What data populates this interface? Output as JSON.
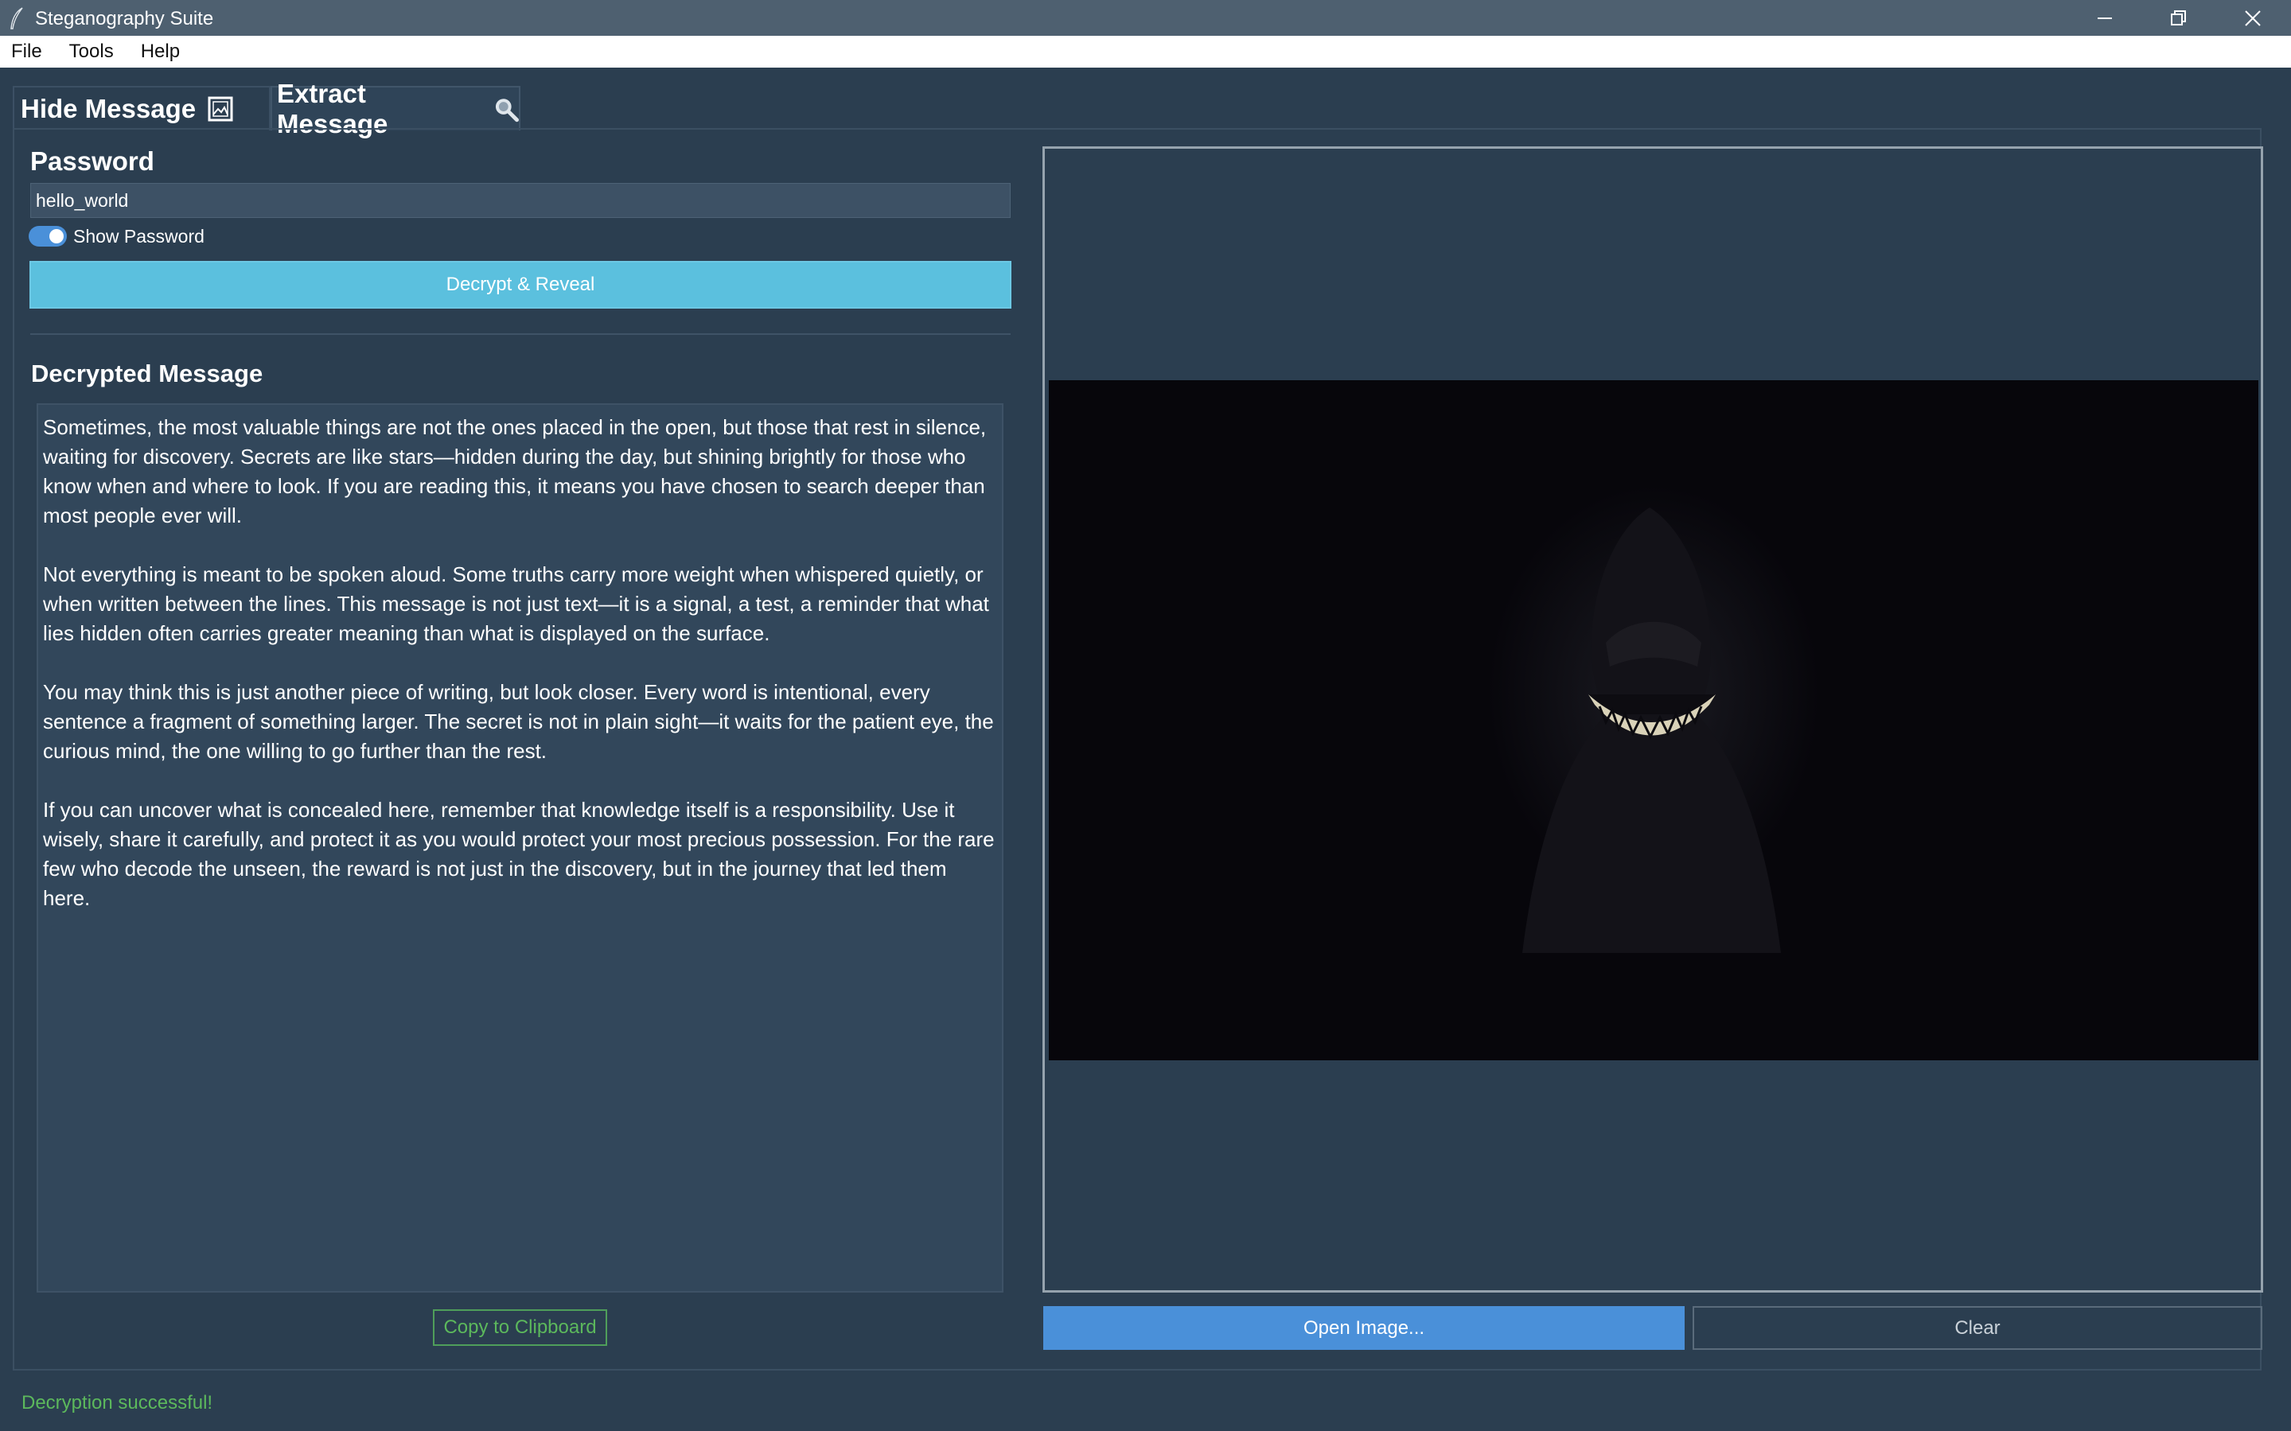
{
  "window": {
    "title": "Steganography Suite",
    "icon": "feather-icon",
    "controls": [
      "minimize-icon",
      "restore-icon",
      "close-icon"
    ]
  },
  "menu": {
    "items": [
      "File",
      "Tools",
      "Help"
    ]
  },
  "tabs": [
    {
      "label": "Hide Message",
      "icon": "image-icon",
      "active": false
    },
    {
      "label": "Extract Message",
      "icon": "magnifier-icon",
      "active": true
    }
  ],
  "password": {
    "label": "Password",
    "value": "hello_world",
    "show_password_label": "Show Password",
    "show_password_on": true
  },
  "decrypt_button": "Decrypt & Reveal",
  "decrypted": {
    "label": "Decrypted Message",
    "paragraphs": [
      "Sometimes, the most valuable things are not the ones placed in the open, but those that rest in silence, waiting for discovery. Secrets are like stars—hidden during the day, but shining brightly for those who know when and where to look. If you are reading this, it means you have chosen to search deeper than most people ever will.",
      "Not everything is meant to be spoken aloud. Some truths carry more weight when whispered quietly, or when written between the lines. This message is not just text—it is a signal, a test, a reminder that what lies hidden often carries greater meaning than what is displayed on the surface.",
      "You may think this is just another piece of writing, but look closer. Every word is intentional, every sentence a fragment of something larger. The secret is not in plain sight—it waits for the patient eye, the curious mind, the one willing to go further than the rest.",
      "If you can uncover what is concealed here, remember that knowledge itself is a responsibility. Use it wisely, share it carefully, and protect it as you would protect your most precious possession. For the rare few who decode the unseen, the reward is not just in the discovery, but in the journey that led them here."
    ]
  },
  "copy_button": "Copy to Clipboard",
  "open_button": "Open Image...",
  "clear_button": "Clear",
  "status": "Decryption successful!",
  "colors": {
    "background": "#2b3e50",
    "accent_blue": "#4a90d9",
    "info_button": "#5bc0de",
    "success_green": "#5cb85c"
  }
}
